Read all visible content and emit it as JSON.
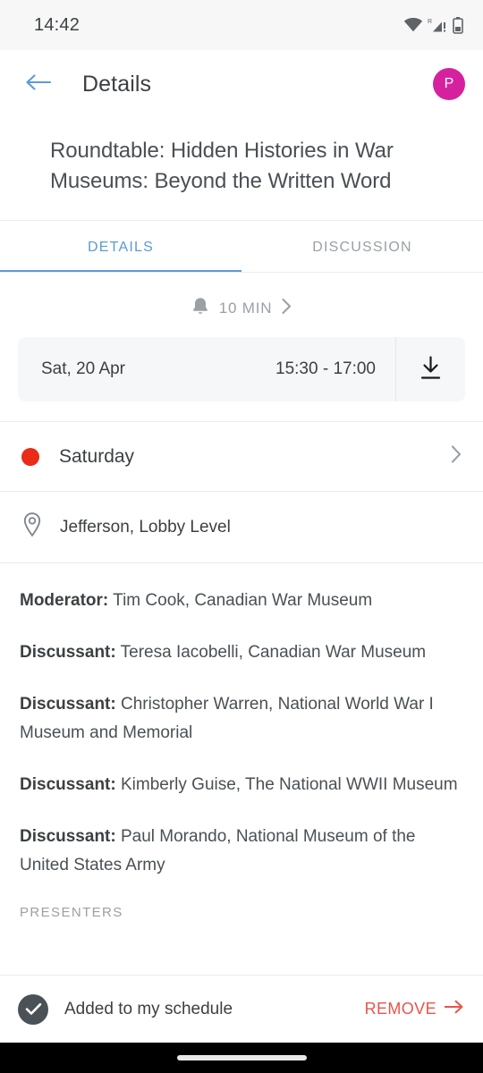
{
  "status_bar": {
    "time": "14:42",
    "icons": [
      "wifi-icon",
      "roaming-signal-icon",
      "battery-icon"
    ]
  },
  "app_bar": {
    "back_icon": "arrow-left-icon",
    "title": "Details",
    "avatar_initial": "P",
    "avatar_color": "#d6219e",
    "accent_color": "#5b9bd5"
  },
  "session": {
    "title": "Roundtable: Hidden Histories in War Museums: Beyond the Written Word"
  },
  "tabs": [
    {
      "label": "DETAILS",
      "active": true
    },
    {
      "label": "DISCUSSION",
      "active": false
    }
  ],
  "reminder": {
    "icon": "bell-icon",
    "label": "10 MIN",
    "chevron": "chevron-right-icon"
  },
  "date_card": {
    "date": "Sat, 20 Apr",
    "time": "15:30 - 17:00",
    "action_icon": "download-icon"
  },
  "day_row": {
    "dot_color": "#ea2b18",
    "label": "Saturday",
    "chevron": "chevron-right-icon"
  },
  "location_row": {
    "icon": "map-pin-icon",
    "label": "Jefferson, Lobby Level"
  },
  "people": [
    {
      "role": "Moderator:",
      "name": "Tim Cook, Canadian War Museum"
    },
    {
      "role": "Discussant:",
      "name": "Teresa Iacobelli, Canadian War Museum"
    },
    {
      "role": "Discussant:",
      "name": "Christopher Warren, National World War I Museum and Memorial"
    },
    {
      "role": "Discussant:",
      "name": "Kimberly Guise, The National WWII Museum"
    },
    {
      "role": "Discussant:",
      "name": "Paul Morando, National Museum of the United States Army"
    }
  ],
  "section_label": "PRESENTERS",
  "bottom_bar": {
    "check_icon": "check-circle-icon",
    "status_text": "Added to my schedule",
    "remove_label": "REMOVE",
    "remove_icon": "arrow-right-icon",
    "remove_color": "#e8544b"
  }
}
